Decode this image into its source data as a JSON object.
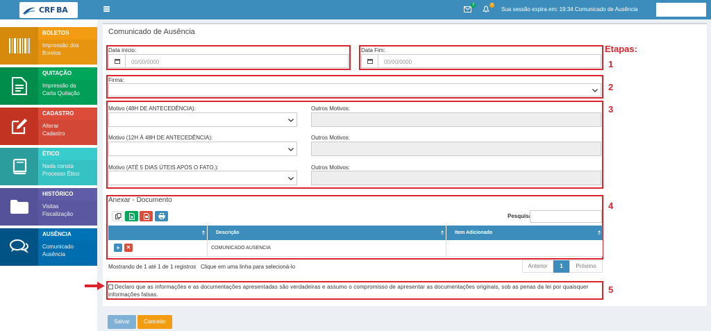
{
  "header": {
    "logo_text": "CRF",
    "logo_suffix": "BA",
    "mail_badge": "2",
    "bell_badge": "3",
    "session_text": "Sua sessão expira em: 19:34 Comunicado de Ausência"
  },
  "sidebar": [
    {
      "title": "BOLETOS",
      "line1": "Impressão dos",
      "line2": "Boletos",
      "icon": "barcode-icon",
      "dark": "#d68a0c",
      "header": "#f39c12",
      "body": "#f39c12"
    },
    {
      "title": "QUITAÇÃO",
      "line1": "Impressão da",
      "line2": "Carta Quitação",
      "icon": "document-icon",
      "dark": "#008d4c",
      "header": "#00a65a",
      "body": "#00a65a"
    },
    {
      "title": "CADASTRO",
      "line1": "Alterar",
      "line2": "Cadastro",
      "icon": "edit-icon",
      "dark": "#c23321",
      "header": "#dd4b39",
      "body": "#dd4b39"
    },
    {
      "title": "ÉTICO",
      "line1": "Nada consta",
      "line2": "Processo Ético",
      "icon": "book-icon",
      "dark": "#2b9d9d",
      "header": "#39cccc",
      "body": "#39cccc"
    },
    {
      "title": "HISTÓRICO",
      "line1": "Visitas",
      "line2": "Fiscalização",
      "icon": "folder-icon",
      "dark": "#555299",
      "header": "#605ca8",
      "body": "#605ca8"
    },
    {
      "title": "AUSÊNCIA",
      "line1": "Comunicado",
      "line2": "Ausência",
      "icon": "chat-icon",
      "dark": "#005384",
      "header": "#0073b7",
      "body": "#0073b7"
    }
  ],
  "form": {
    "title": "Comunicado de Ausência",
    "data_inicio_label": "Data início:",
    "data_inicio_placeholder": "00/00/0000",
    "data_fim_label": "Data Fim:",
    "data_fim_placeholder": "00/00/0000",
    "firma_label": "Firma:",
    "motivo1_label": "Motivo (48H DE ANTECEDÊNCIA):",
    "motivo2_label": "Motivo (12H À 48H DE ANTECEDÊNCIA):",
    "motivo3_label": "Motivo (ATÉ 5 DIAS ÚTEIS APÓS O FATO.):",
    "outros_label": "Outros Motivos:"
  },
  "steps": {
    "title": "Etapas:",
    "s1": "1",
    "s2": "2",
    "s3": "3",
    "s4": "4",
    "s5": "5"
  },
  "attach": {
    "title": "Anexar - Documento",
    "search_label": "Pesquisar",
    "columns": [
      "",
      "Descrição",
      "Item Adicionado"
    ],
    "rows": [
      {
        "descricao": "COMUNICADO AUSENCIA",
        "item": ""
      }
    ],
    "info": "Mostrando de 1 até 1 de 1 registros",
    "hint": "Clique em uma linha para selecioná-lo",
    "prev": "Anterior",
    "page": "1",
    "next": "Próximo"
  },
  "declaration": "Declaro que as informações e as documentações apresentadas são verdadeiras e assumo o compromisso de apresentar as documentações originais, sob as penas da lei por quaisquer informações falsas.",
  "actions": {
    "save": "Salvar",
    "cancel": "Cancelar"
  },
  "colors": {
    "topbar": "#3c8dbc",
    "annotation_red": "#d9232d",
    "save": "#7fb0d6",
    "cancel": "#f39c12"
  }
}
